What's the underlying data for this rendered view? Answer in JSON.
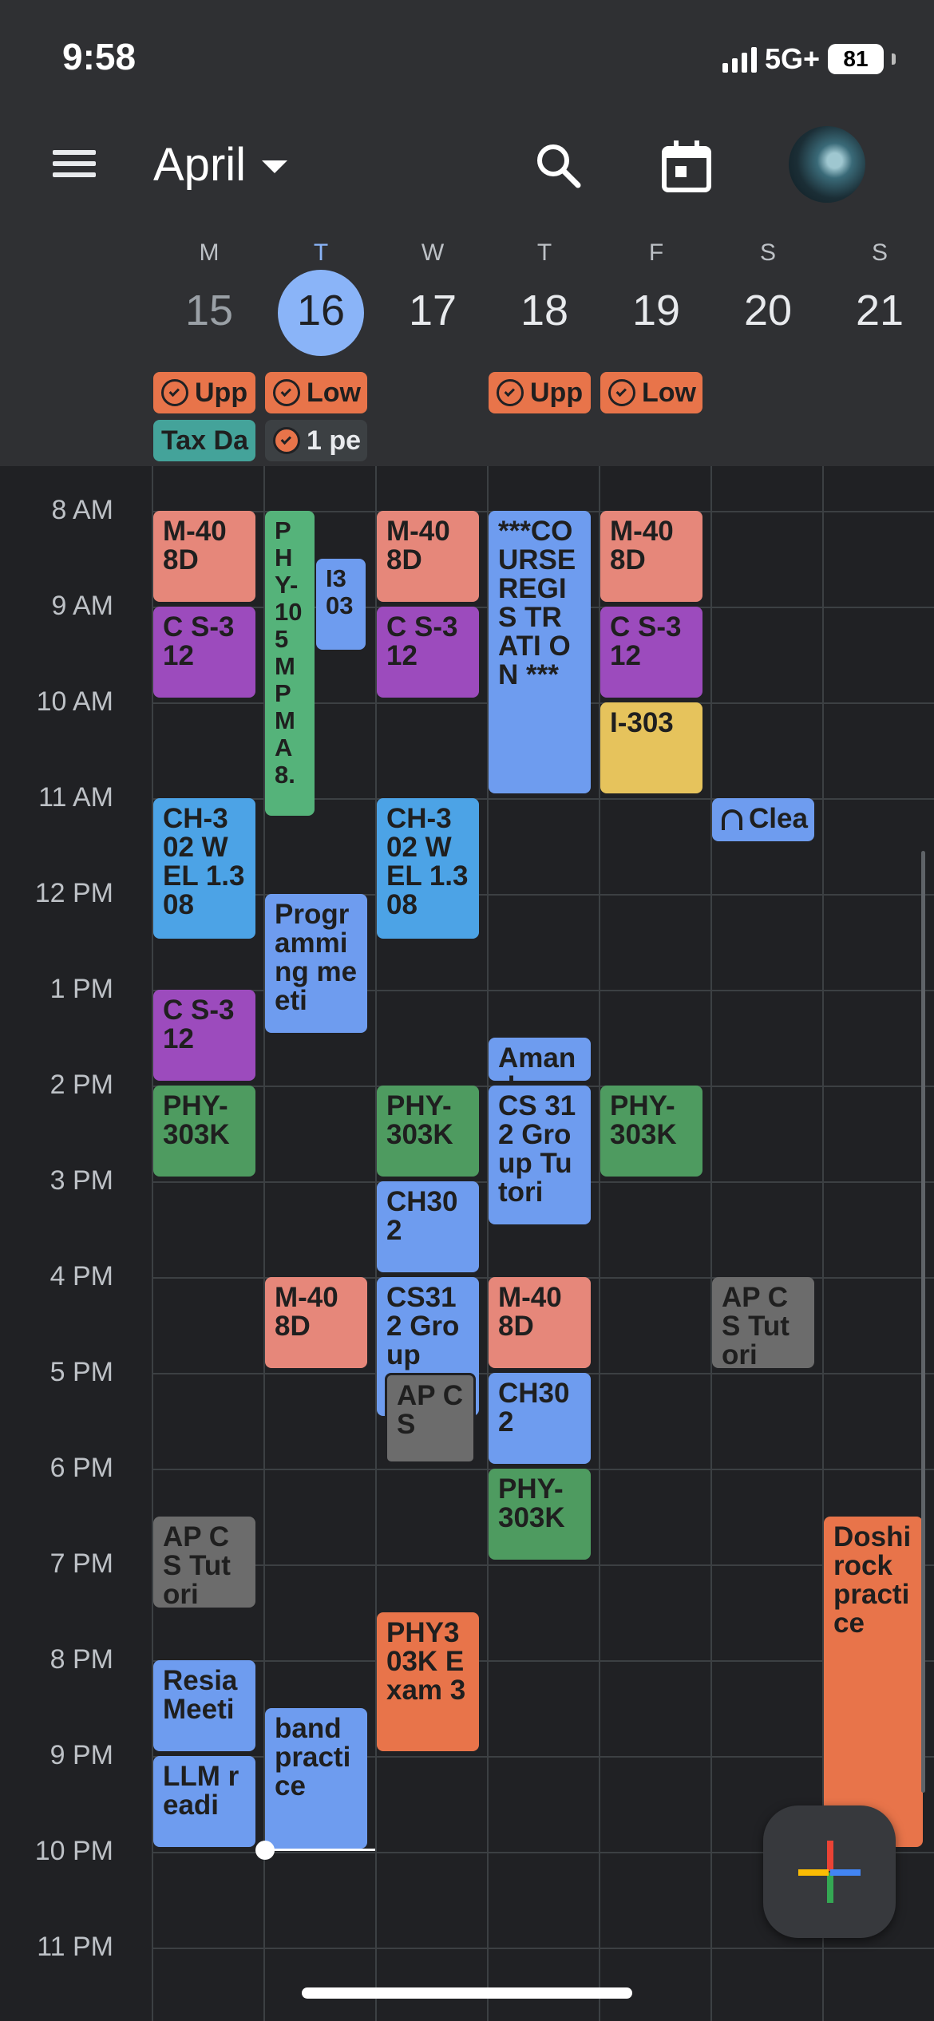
{
  "status_bar": {
    "time": "9:58",
    "network": "5G+",
    "battery": "81"
  },
  "header": {
    "month": "April"
  },
  "week": {
    "days": [
      {
        "dow": "M",
        "date": "15"
      },
      {
        "dow": "T",
        "date": "16",
        "today": true
      },
      {
        "dow": "W",
        "date": "17"
      },
      {
        "dow": "T",
        "date": "18"
      },
      {
        "dow": "F",
        "date": "19"
      },
      {
        "dow": "S",
        "date": "20"
      },
      {
        "dow": "S",
        "date": "21"
      }
    ]
  },
  "all_day": [
    {
      "day": "M",
      "label": "Upp",
      "task": true,
      "color": "#e8744a"
    },
    {
      "day": "T",
      "label": "Low",
      "task": true,
      "color": "#e8744a"
    },
    {
      "day": "T",
      "label": "Upp",
      "task": true,
      "color": "#e8744a"
    },
    {
      "day": "F",
      "label": "Low",
      "task": true,
      "color": "#e8744a"
    },
    {
      "day": "M",
      "label": "Tax Da",
      "task": false,
      "color": "#44a39a"
    },
    {
      "day": "T",
      "label": "1 pe",
      "task": true,
      "color": "#3c4043"
    }
  ],
  "hours": [
    "8 AM",
    "9 AM",
    "10 AM",
    "11 AM",
    "12 PM",
    "1 PM",
    "2 PM",
    "3 PM",
    "4 PM",
    "5 PM",
    "6 PM",
    "7 PM",
    "8 PM",
    "9 PM",
    "10 PM",
    "11 PM"
  ],
  "events": [
    {
      "title": "M-40 8D",
      "day": "Mon",
      "color": "#e6877a"
    },
    {
      "title": "C S-312",
      "day": "Mon",
      "color": "#9c4bbd"
    },
    {
      "title": "CH-3 02 WEL 1.308",
      "day": "Mon",
      "color": "#4ca3e6"
    },
    {
      "title": "C S-312",
      "day": "Mon",
      "color": "#9c4bbd"
    },
    {
      "title": "PHY- 303K",
      "day": "Mon",
      "color": "#4e9b60"
    },
    {
      "title": "AP CS Tutori",
      "day": "Mon",
      "color": "#6c6c6c"
    },
    {
      "title": "Resia Meeti",
      "day": "Mon",
      "color": "#6e9cef"
    },
    {
      "title": "LLM readi",
      "day": "Mon",
      "color": "#6e9cef"
    },
    {
      "title": "P H Y- 10 5 M P M A 8.",
      "day": "Tue",
      "color": "#55b37a"
    },
    {
      "title": "I3 03",
      "day": "Tue",
      "color": "#6e9cef"
    },
    {
      "title": "Progr ammi ng meeti",
      "day": "Tue",
      "color": "#6e9cef"
    },
    {
      "title": "M-40 8D",
      "day": "Tue",
      "color": "#e6877a"
    },
    {
      "title": "band practi ce",
      "day": "Tue",
      "color": "#6e9cef"
    },
    {
      "title": "M-40 8D",
      "day": "Wed",
      "color": "#e6877a"
    },
    {
      "title": "C S-312",
      "day": "Wed",
      "color": "#9c4bbd"
    },
    {
      "title": "CH-3 02 WEL 1.308",
      "day": "Wed",
      "color": "#4ca3e6"
    },
    {
      "title": "PHY- 303K",
      "day": "Wed",
      "color": "#4e9b60"
    },
    {
      "title": "CH30 2",
      "day": "Wed",
      "color": "#6e9cef"
    },
    {
      "title": "CS31 2 Group",
      "day": "Wed",
      "color": "#6e9cef"
    },
    {
      "title": "AP CS",
      "day": "Wed",
      "color": "#6c6c6c"
    },
    {
      "title": "PHY3 03K Exam 3",
      "day": "Wed",
      "color": "#e8744a"
    },
    {
      "title": "***CO URSE REGIS TRATI ON ***",
      "day": "Thu",
      "color": "#6e9cef"
    },
    {
      "title": "Amand",
      "day": "Thu",
      "color": "#6e9cef"
    },
    {
      "title": "CS 312 Group Tutori",
      "day": "Thu",
      "color": "#6e9cef"
    },
    {
      "title": "M-40 8D",
      "day": "Thu",
      "color": "#e6877a"
    },
    {
      "title": "CH30 2",
      "day": "Thu",
      "color": "#6e9cef"
    },
    {
      "title": "PHY- 303K",
      "day": "Thu",
      "color": "#4e9b60"
    },
    {
      "title": "M-40 8D",
      "day": "Fri",
      "color": "#e6877a"
    },
    {
      "title": "C S-312",
      "day": "Fri",
      "color": "#9c4bbd"
    },
    {
      "title": "I-303",
      "day": "Fri",
      "color": "#e6c35c"
    },
    {
      "title": "PHY- 303K",
      "day": "Fri",
      "color": "#4e9b60"
    },
    {
      "title": "Clea",
      "day": "Sat",
      "color": "#6e9cef",
      "icon": "headphones-icon"
    },
    {
      "title": "AP CS Tutori",
      "day": "Sat",
      "color": "#6c6c6c"
    },
    {
      "title": "Doshi rock practi ce",
      "day": "Sun",
      "color": "#e8744a"
    }
  ],
  "icons": {
    "menu": "menu-icon",
    "search": "search-icon",
    "today": "calendar-today-icon",
    "create": "plus-icon"
  }
}
